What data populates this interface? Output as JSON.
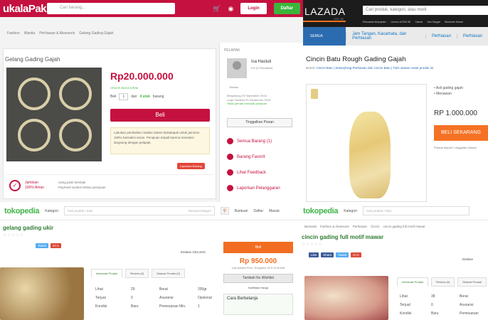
{
  "bukalapak": {
    "logo": "ukalaPak",
    "logo_sub": ".com",
    "search_placeholder": "Cari barang...",
    "cart_icon": "cart-icon",
    "camera_icon": "camera-icon",
    "login": "Login",
    "daftar": "Daftar",
    "breadcrumbs": [
      "Fashion",
      "Wanita",
      "Perhiasan & Aksesoris",
      "Gelang Gading Gajah"
    ],
    "product_title": "Gelang Gading Gajah",
    "price": "Rp20.000.000",
    "shipping": "GRATIS BIAYA KIRIM",
    "qty_label": "Beli",
    "qty_value": "1",
    "stock_prefix": "dari",
    "stock": "4 stok",
    "stock_suffix": "barang",
    "buy_button": "Beli",
    "note": "Lakukan pembelian melalui sistem Bukalapak untuk jaminan 100% transaksi aman. Penipuan terjadi karena transaksi langsung dengan pelapak.",
    "report": "Laporkan Barang",
    "guarantee_line1": "Jaminan",
    "guarantee_line2": "100% Aman",
    "guarantee_items": [
      "Uang pasti kembali",
      "Payment system bebas penipuan"
    ],
    "seller_header": "PELAPAK",
    "seller_name": "Ica Hastuti",
    "seller_feedback": "0% (0 Feedback)",
    "seller_location": "Bekasi",
    "seller_joined": "Bergabung 25 September 2015",
    "seller_login": "Login Terakhir 25 September 2015",
    "seller_response": "Tidak pernah menolak pesanan",
    "message_button": "Tinggalkan Pesan",
    "seller_links": [
      "Semua Barang (1)",
      "Barang Favorit",
      "Lihat Feedback",
      "Laporkan Pelanggaran"
    ]
  },
  "lazada": {
    "logo": "LAZADA",
    "logo_sub": ".CO.ID",
    "search_placeholder": "Cari produk, kategori, atau merk",
    "nav": [
      "Pencarian terpopuler:",
      "Lenovo A7000 SE",
      "Xiaomi",
      "Jam Tangan",
      "Beckover Murah"
    ],
    "all_categories": "SEMUA KATEGORI",
    "categories": [
      "Jam Tangan, Kacamata, dan Perhiasan",
      "Perhiasan",
      "Perhiasan"
    ],
    "product_title": "Cincin Batu Rough Gading Gajah",
    "brand_label": "Brand:",
    "brand_links": "Cincin Batu | Sekarybrag Perhiasan dari Cincin Batu | Tulis ulasan untuk produk ini",
    "features": [
      "Asli gading gajah",
      "Menawan"
    ],
    "price": "RP 1.000.000",
    "buy_button": "BELI SEKARANG",
    "sold": "Produk terjual 1 Unggulan Ulasan"
  },
  "tokopedia1": {
    "logo": "tokopedia",
    "kategori": "Kategori",
    "search_placeholder": "Cari produk / toko",
    "search_scope": "Semua Kategori",
    "nav": [
      "Bantuan",
      "Daftar",
      "Masuk"
    ],
    "product_title": "gelang gading ukir",
    "tweet": "Tweet",
    "gplus": "G+1",
    "etalase": "Etalase GELANG",
    "tabs": [
      "Informasi Produk",
      "Review (0)",
      "Diskusi Produk (0)"
    ],
    "info_rows": [
      [
        "Lihat",
        "29",
        "Berat",
        "200gr"
      ],
      [
        "Terjual",
        "0",
        "Asuransi",
        "Opsional"
      ],
      [
        "Kondisi",
        "Baru",
        "Pemesanan Min.",
        "1"
      ]
    ],
    "buy_button": "Beli",
    "price": "Rp 950.000",
    "updated": "Last updated Price: 28 Agustus 2015 19:45 WIB",
    "wishlist": "Tambah Ke Wishlist",
    "notify": "Notifikasi Harga",
    "how_to": "Cara Berbelanja"
  },
  "tokopedia2": {
    "logo": "tokopedia",
    "kategori": "Kategori",
    "search_placeholder": "Cari produk / toko",
    "breadcrumbs": [
      "Beranda",
      "Fashion & Aksesoris",
      "Perhiasan",
      "Cincin",
      "cincin gading full motif mawar"
    ],
    "product_title": "cincin gading full motif mawar",
    "like": "Like",
    "share": "Share",
    "tweet": "Tweet",
    "gplus": "G+1",
    "etalase": "Etalase",
    "tabs": [
      "Informasi Produk",
      "Review (0)",
      "Diskusi Produk"
    ],
    "info_rows": [
      [
        "Lihat",
        "38",
        "Berat"
      ],
      [
        "Terjual",
        "0",
        "Asuransi"
      ],
      [
        "Kondisi",
        "Baru",
        "Pemesanan"
      ]
    ]
  }
}
